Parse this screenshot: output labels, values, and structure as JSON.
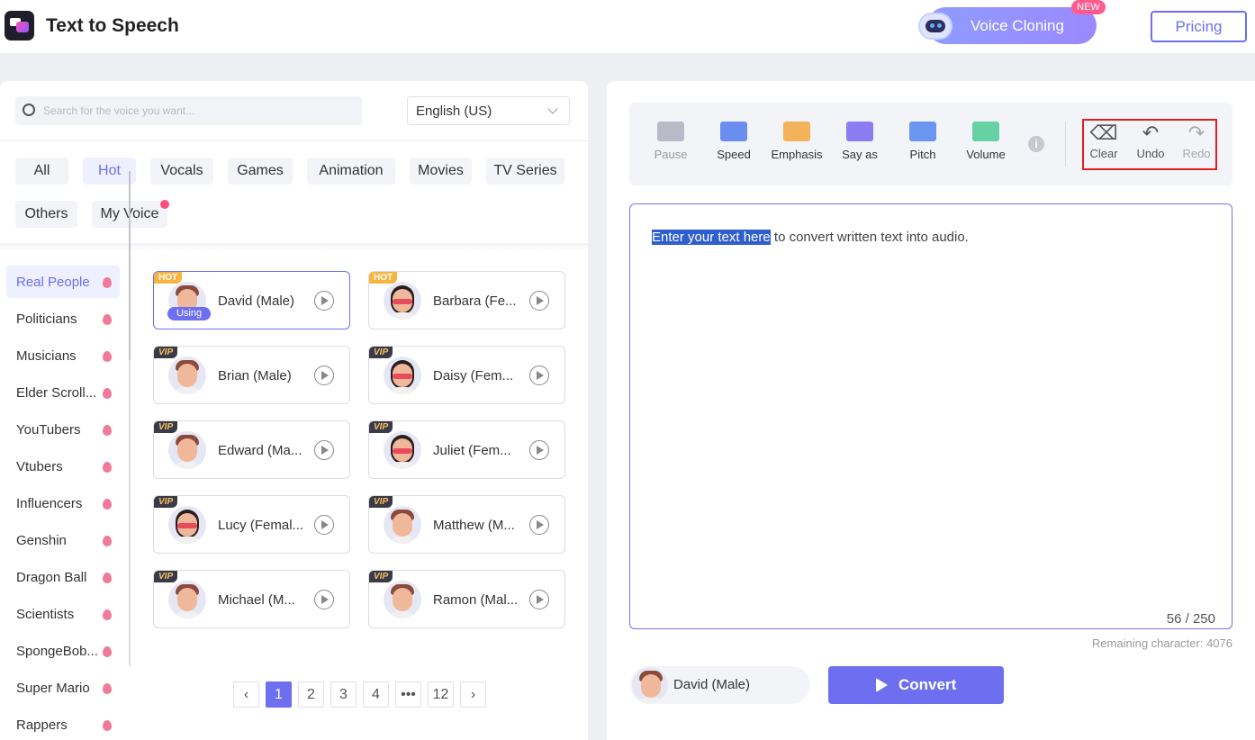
{
  "header": {
    "app_title": "Text to Speech",
    "voice_cloning_label": "Voice Cloning",
    "new_badge": "NEW",
    "pricing_label": "Pricing"
  },
  "search": {
    "placeholder": "Search for the voice you want..."
  },
  "language": {
    "selected": "English (US)"
  },
  "filters": [
    "All",
    "Hot",
    "Vocals",
    "Games",
    "Animation",
    "Movies",
    "TV Series",
    "Others",
    "My Voice"
  ],
  "active_filter": "Hot",
  "categories": [
    "Real People",
    "Politicians",
    "Musicians",
    "Elder Scroll...",
    "YouTubers",
    "Vtubers",
    "Influencers",
    "Genshin",
    "Dragon Ball",
    "Scientists",
    "SpongeBob...",
    "Super Mario",
    "Rappers"
  ],
  "active_category": "Real People",
  "voices": [
    {
      "name": "David (Male)",
      "tag": "HOT",
      "badge": "Using"
    },
    {
      "name": "Barbara (Fe...",
      "tag": "HOT"
    },
    {
      "name": "Brian (Male)",
      "tag": "VIP"
    },
    {
      "name": "Daisy (Fem...",
      "tag": "VIP"
    },
    {
      "name": "Edward (Ma...",
      "tag": "VIP"
    },
    {
      "name": "Juliet (Fem...",
      "tag": "VIP"
    },
    {
      "name": "Lucy (Femal...",
      "tag": "VIP"
    },
    {
      "name": "Matthew (M...",
      "tag": "VIP"
    },
    {
      "name": "Michael (M...",
      "tag": "VIP"
    },
    {
      "name": "Ramon (Mal...",
      "tag": "VIP"
    }
  ],
  "pagination": {
    "pages": [
      "1",
      "2",
      "3",
      "4",
      "•••",
      "12"
    ],
    "current": "1",
    "prev": "‹",
    "next": "›"
  },
  "toolbar": {
    "tools": [
      "Pause",
      "Speed",
      "Emphasis",
      "Say as",
      "Pitch",
      "Volume"
    ],
    "info": "i",
    "edit_tools": [
      "Clear",
      "Undo",
      "Redo"
    ]
  },
  "editor": {
    "highlighted_text": "Enter your text here",
    "rest_text": " to convert written text into audio.",
    "char_count": "56 / 250",
    "remaining": "Remaining character: 4076"
  },
  "selected_voice": {
    "name": "David (Male)"
  },
  "convert_label": "Convert",
  "colors": {
    "accent": "#6d6ff0",
    "hot": "#f7b43f",
    "highlight": "#e02020"
  }
}
